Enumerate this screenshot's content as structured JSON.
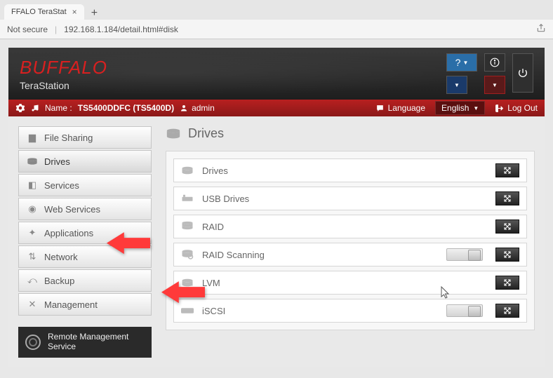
{
  "browser": {
    "tab_title": "FFALO TeraStat",
    "security": "Not secure",
    "url": "192.168.1.184/detail.html#disk"
  },
  "brand": {
    "logo": "BUFFALO",
    "product": "TeraStation"
  },
  "header_buttons": {
    "help": "?"
  },
  "infobar": {
    "name_label": "Name :",
    "name_value": "TS5400DDFC (TS5400D)",
    "user": "admin",
    "language_label": "Language",
    "language_value": "English",
    "logout": "Log Out"
  },
  "sidebar": {
    "items": [
      {
        "label": "File Sharing"
      },
      {
        "label": "Drives"
      },
      {
        "label": "Services"
      },
      {
        "label": "Web Services"
      },
      {
        "label": "Applications"
      },
      {
        "label": "Network"
      },
      {
        "label": "Backup"
      },
      {
        "label": "Management"
      }
    ],
    "remote_label_l1": "Remote Management",
    "remote_label_l2": "Service"
  },
  "page": {
    "title": "Drives",
    "rows": [
      {
        "label": "Drives",
        "toggle": false
      },
      {
        "label": "USB Drives",
        "toggle": false
      },
      {
        "label": "RAID",
        "toggle": false
      },
      {
        "label": "RAID Scanning",
        "toggle": true
      },
      {
        "label": "LVM",
        "toggle": false
      },
      {
        "label": "iSCSI",
        "toggle": true
      }
    ]
  }
}
